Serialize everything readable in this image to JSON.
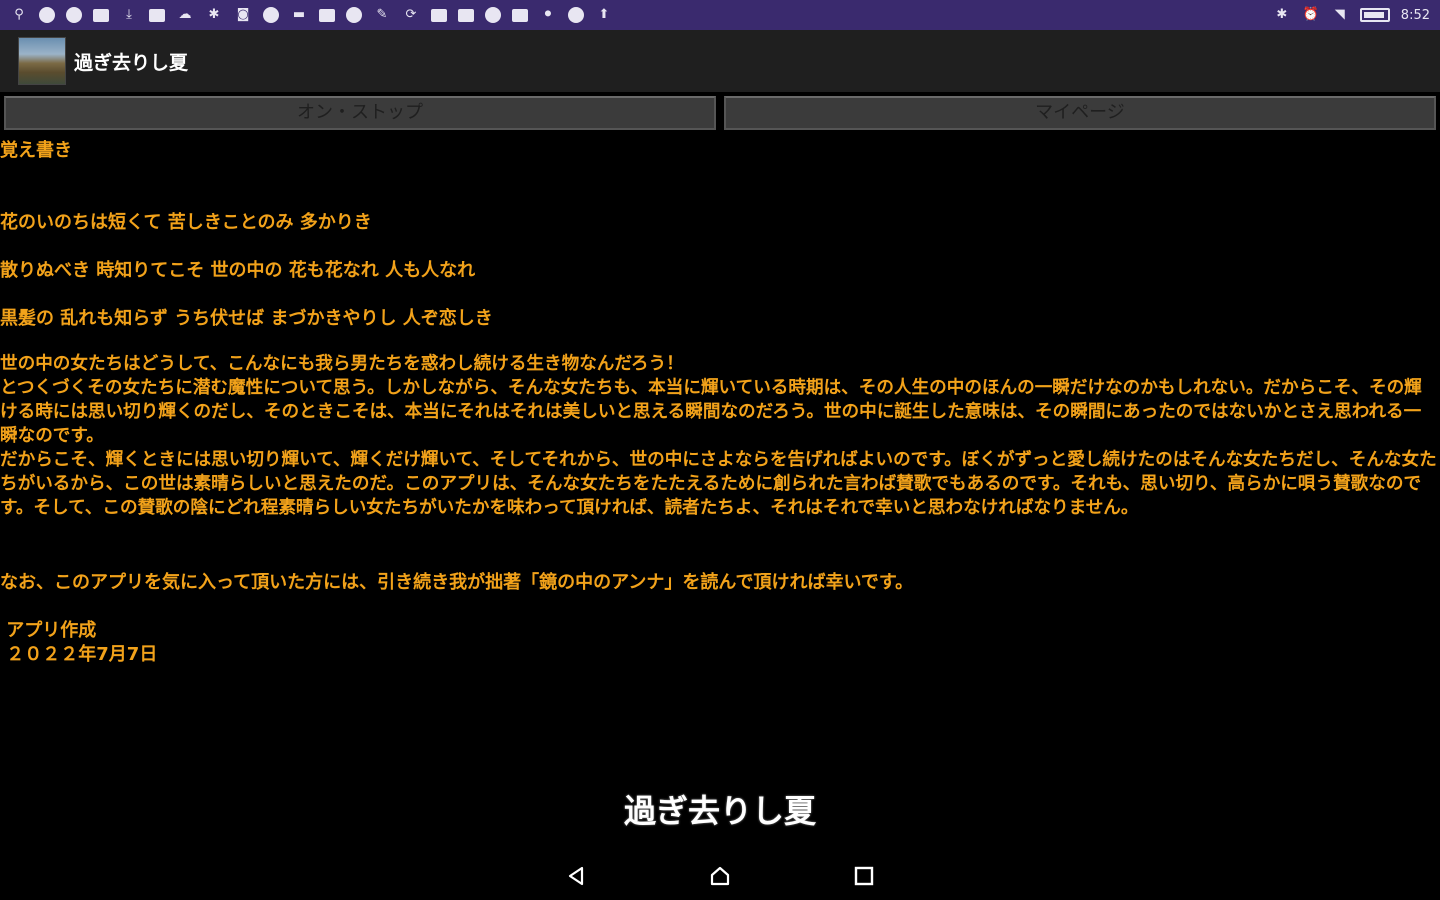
{
  "statusbar": {
    "time": "8:52",
    "left_icons": [
      "usb-icon",
      "globe-icon",
      "chrome-icon",
      "image-icon",
      "download-icon",
      "calendar-icon",
      "cloud-icon",
      "bluetooth-icon",
      "watch-icon",
      "plus-icon",
      "mail-icon",
      "youtube-icon",
      "photos-icon",
      "edit-icon",
      "sync-icon",
      "tv-icon",
      "keyboard-icon",
      "location-icon",
      "gallery-icon",
      "mic-icon",
      "record-icon",
      "upload-icon"
    ],
    "right_icons": [
      "bluetooth-icon",
      "alarm-icon",
      "wifi-icon",
      "battery-icon"
    ]
  },
  "actionbar": {
    "title": "過ぎ去りし夏"
  },
  "tabs": [
    {
      "label": "オン・ストップ"
    },
    {
      "label": "マイページ"
    }
  ],
  "content": {
    "heading": "覚え書き",
    "poem": [
      "花のいのちは短くて 苦しきことのみ 多かりき",
      "散りぬべき 時知りてこそ 世の中の 花も花なれ 人も人なれ",
      "黒髪の 乱れも知らず うち伏せば まづかきやりし 人ぞ恋しき"
    ],
    "body": "世の中の女たちはどうして、こんなにも我ら男たちを惑わし続ける生き物なんだろう！\nとつくづくその女たちに潜む魔性について思う。しかしながら、そんな女たちも、本当に輝いている時期は、その人生の中のほんの一瞬だけなのかもしれない。だからこそ、その輝ける時には思い切り輝くのだし、そのときこそは、本当にそれはそれは美しいと思える瞬間なのだろう。世の中に誕生した意味は、その瞬間にあったのではないかとさえ思われる一瞬なのです。\nだからこそ、輝くときには思い切り輝いて、輝くだけ輝いて、そしてそれから、世の中にさよならを告げればよいのです。ぼくがずっと愛し続けたのはそんな女たちだし、そんな女たちがいるから、この世は素晴らしいと思えたのだ。このアプリは、そんな女たちをたたえるために創られた言わば賛歌でもあるのです。それも、思い切り、高らかに唄う賛歌なのです。そして、この賛歌の陰にどれ程素晴らしい女たちがいたかを味わって頂ければ、読者たちよ、それはそれで幸いと思わなければなりません。",
    "note": "なお、このアプリを気に入って頂いた方には、引き続き我が拙著「鏡の中のアンナ」を読んで頂ければ幸いです。",
    "signature_line1": " アプリ作成",
    "signature_line2": " ２０２２年7月7日"
  },
  "bottom_title": "過ぎ去りし夏",
  "navbar": {
    "buttons": [
      "back-icon",
      "home-icon",
      "recents-icon"
    ]
  },
  "colors": {
    "statusbar": "#3a2a6e",
    "actionbar": "#1f1f1f",
    "text": "#f2a21a",
    "background": "#000000"
  }
}
